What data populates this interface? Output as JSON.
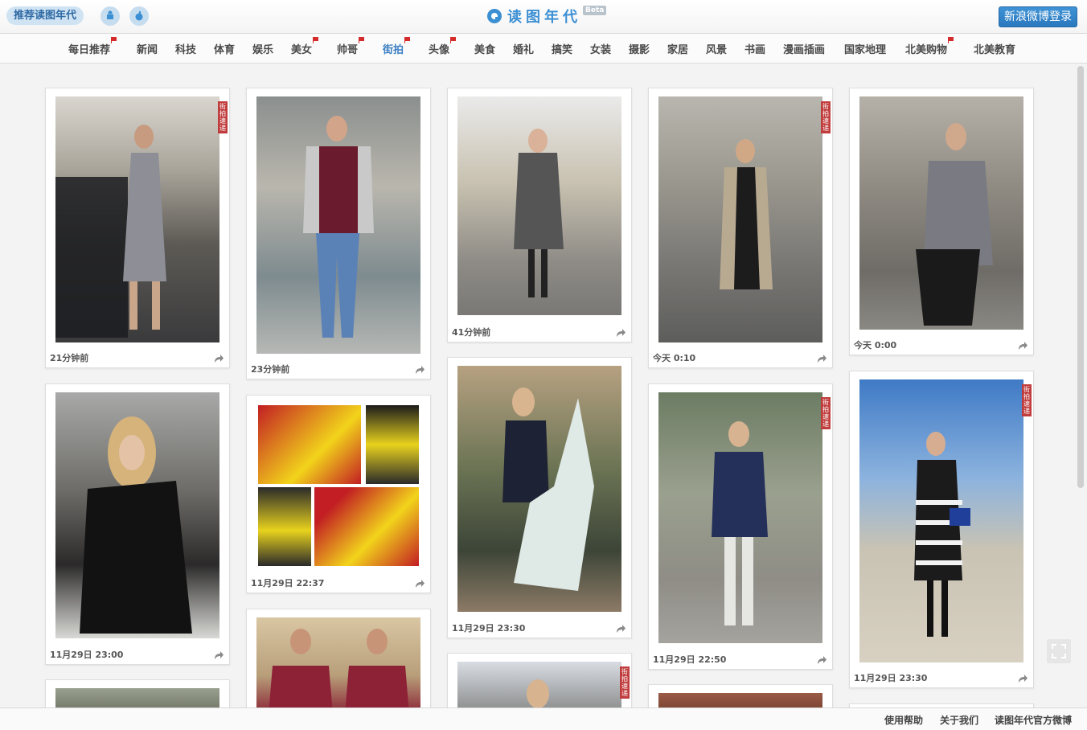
{
  "topbar": {
    "recommend_label": "推荐读图年代",
    "logo_text": "读图年代",
    "beta_label": "Beta",
    "login_label": "新浪微博登录",
    "android_icon": "android-icon",
    "apple_icon": "apple-icon"
  },
  "nav": {
    "items": [
      {
        "label": "每日推荐",
        "flag": true
      },
      {
        "label": "新闻",
        "flag": false
      },
      {
        "label": "科技",
        "flag": false
      },
      {
        "label": "体育",
        "flag": false
      },
      {
        "label": "娱乐",
        "flag": false
      },
      {
        "label": "美女",
        "flag": true
      },
      {
        "label": "帅哥",
        "flag": true
      },
      {
        "label": "街拍",
        "flag": true,
        "active": true
      },
      {
        "label": "头像",
        "flag": true
      },
      {
        "label": "美食",
        "flag": false
      },
      {
        "label": "婚礼",
        "flag": false
      },
      {
        "label": "搞笑",
        "flag": false
      },
      {
        "label": "女装",
        "flag": false
      },
      {
        "label": "摄影",
        "flag": false
      },
      {
        "label": "家居",
        "flag": false
      },
      {
        "label": "风景",
        "flag": false
      },
      {
        "label": "书画",
        "flag": false
      },
      {
        "label": "漫画插画",
        "flag": false
      },
      {
        "label": "国家地理",
        "flag": false
      },
      {
        "label": "北美购物",
        "flag": true
      },
      {
        "label": "北美教育",
        "flag": false
      }
    ],
    "accent_color": "#3b7fc4",
    "flag_color": "#d62b2b"
  },
  "cards": [
    {
      "time": "21分钟前",
      "tag": "街拍速递",
      "tone": "street-gray"
    },
    {
      "time": "23分钟前",
      "tag": "",
      "tone": "street-warm"
    },
    {
      "time": "41分钟前",
      "tag": "",
      "tone": "street-light"
    },
    {
      "time": "今天 0:10",
      "tag": "街拍速递",
      "tone": "street-gray"
    },
    {
      "time": "今天 0:00",
      "tag": "",
      "tone": "street-stone"
    },
    {
      "time": "11月29日 23:00",
      "tag": "",
      "tone": "street-dark"
    },
    {
      "time": "11月29日 22:37",
      "tag": "",
      "tone": "stage-yellow"
    },
    {
      "time": "11月29日 23:30",
      "tag": "",
      "tone": "carousel"
    },
    {
      "time": "11月29日 22:50",
      "tag": "街拍速递",
      "tone": "street-green"
    },
    {
      "time": "11月29日 23:30",
      "tag": "街拍速递",
      "tone": "sky-blue"
    },
    {
      "time": "",
      "tag": "",
      "tone": "street-gray"
    },
    {
      "time": "",
      "tag": "",
      "tone": "portrait-red"
    },
    {
      "time": "",
      "tag": "街拍速递",
      "tone": "street-light"
    },
    {
      "time": "",
      "tag": "",
      "tone": "street-brick"
    }
  ],
  "share_icon": "share-arrow-icon",
  "footer": {
    "help": "使用帮助",
    "about": "关于我们",
    "weibo": "读图年代官方微博"
  },
  "fullscreen_icon": "fullscreen-icon"
}
